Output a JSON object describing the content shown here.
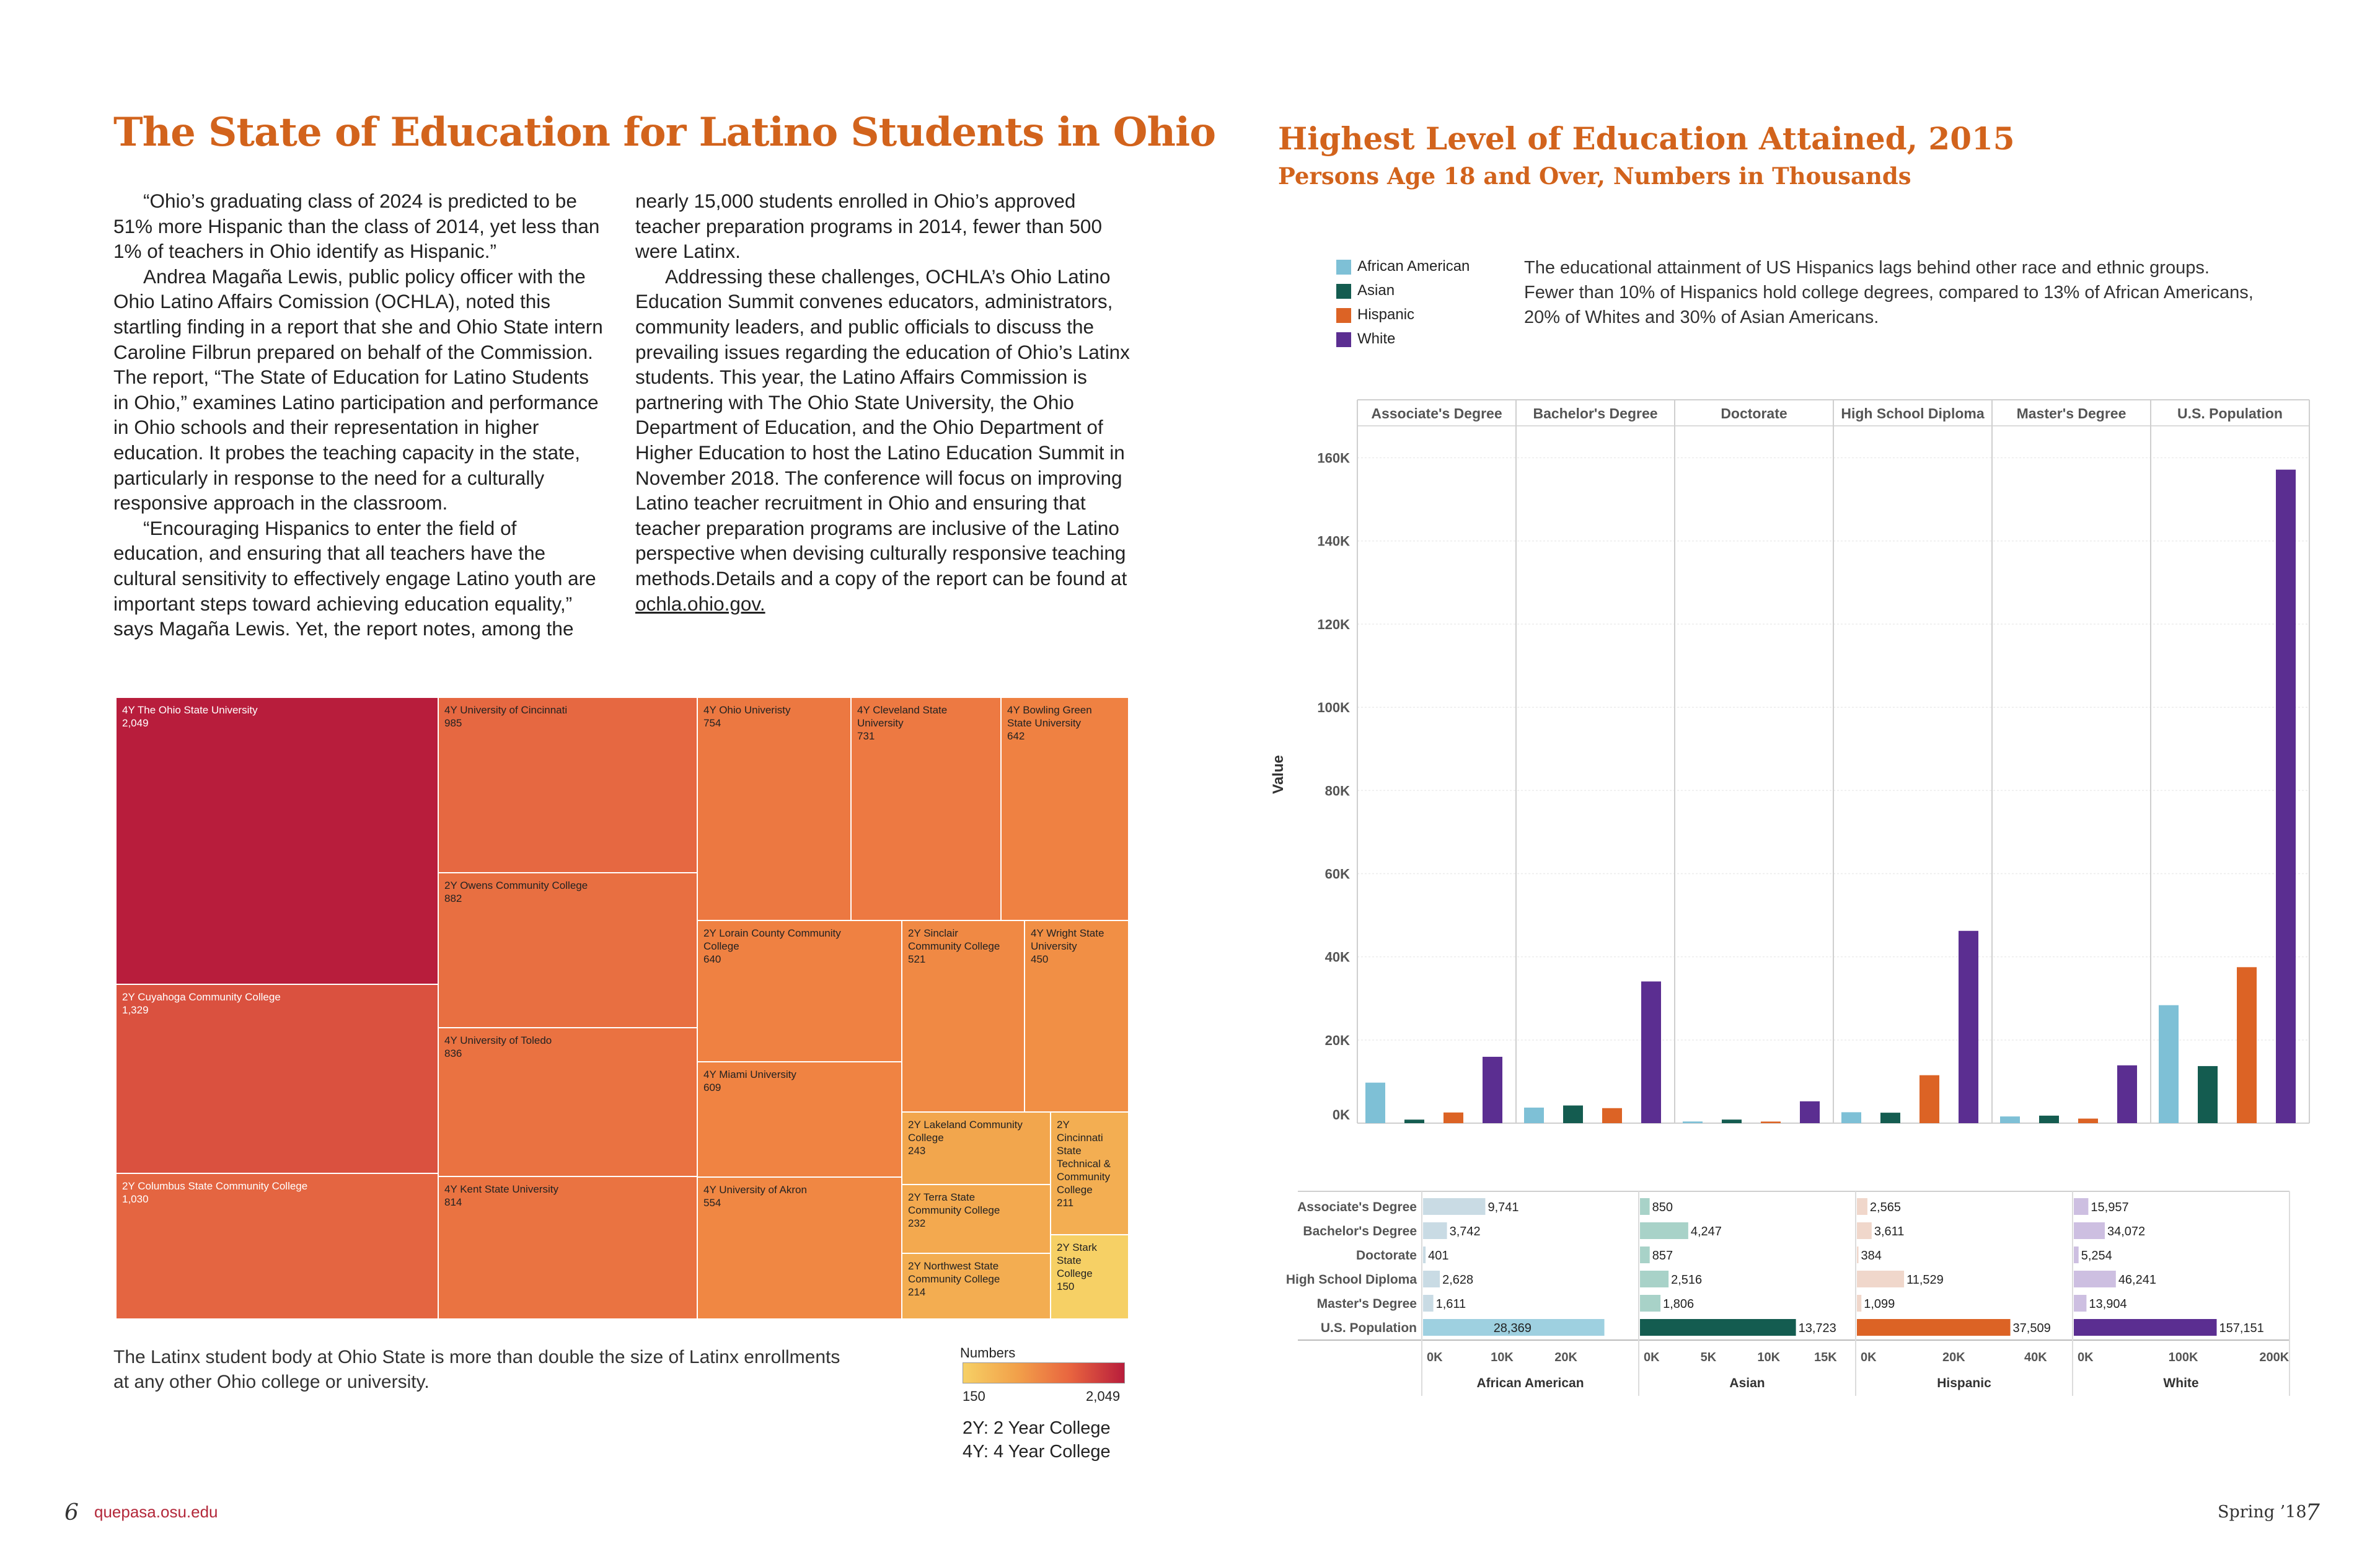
{
  "left_page": {
    "title": "The State of Education for Latino Students in Ohio",
    "col1": [
      "“Ohio’s graduating class of 2024 is predicted to be 51% more Hispanic than the class of 2014, yet less than 1% of teachers in Ohio identify as Hispanic.”",
      "Andrea Magaña Lewis, public policy officer with the Ohio Latino Affairs Comission (OCHLA), noted this startling finding in a report that she and Ohio State intern Caroline Filbrun prepared on behalf of the Commission. The report, “The State of Education for Latino Students in Ohio,” examines Latino participation and performance in Ohio schools and their representation in higher education. It probes the teaching capacity in the state, particularly in response to the need for a culturally responsive approach in the classroom.",
      "“Encouraging Hispanics to enter the field of education, and ensuring that all teachers have the cultural sensitivity to effectively engage Latino youth are important steps toward achieving education equality,” says Magaña Lewis. Yet, the report notes, among the"
    ],
    "col2_p1": "nearly 15,000 students enrolled in Ohio’s approved teacher preparation programs in 2014, fewer than 500 were Latinx.",
    "col2_p2": "Addressing these challenges, OCHLA’s Ohio Latino Education Summit convenes educators, administrators, community leaders, and public officials to discuss the prevailing issues regarding the education of Ohio’s Latinx students. This year, the Latino Affairs Commission is partnering with The Ohio State University, the Ohio Department of Education, and the Ohio Department of Higher Education to host the Latino Education Summit in November 2018. The conference will focus on improving Latino teacher recruitment in Ohio and ensuring that teacher preparation programs are inclusive of the Latino perspective when devising culturally responsive teaching methods.Details and a copy of the report can be found at",
    "col2_link": "ochla.ohio.gov.",
    "caption": "The Latinx student body at Ohio State is more than double the size of Latinx enrollments at any other Ohio college or university.",
    "numbers_legend": {
      "title": "Numbers",
      "min": "150",
      "max": "2,049"
    },
    "key_2y": "2Y: 2 Year College",
    "key_4y": "4Y: 4 Year College",
    "page_number": "6",
    "url": "quepasa.osu.edu"
  },
  "right_page": {
    "title": "Highest Level of Education Attained, 2015",
    "subtitle": "Persons Age 18 and Over, Numbers in Thousands",
    "blurb": "The educational attainment of US Hispanics lags behind other race and ethnic groups.  Fewer than 10% of Hispanics hold college degrees, compared to 13% of African Americans, 20% of Whites and 30% of Asian Americans.",
    "legend": [
      {
        "label": "African American",
        "color": "#7ec0d6"
      },
      {
        "label": "Asian",
        "color": "#145c50"
      },
      {
        "label": "Hispanic",
        "color": "#dc6325"
      },
      {
        "label": "White",
        "color": "#5b2e91"
      }
    ],
    "footer_issue": "Spring ’18",
    "page_number": "7"
  },
  "chart_data": [
    {
      "type": "treemap",
      "color_legend": "Numbers",
      "items": [
        {
          "label": "4Y The Ohio State University",
          "value": 2049,
          "display": "2,049"
        },
        {
          "label": "2Y Cuyahoga Community College",
          "value": 1329,
          "display": "1,329"
        },
        {
          "label": "2Y Columbus State Community College",
          "value": 1030,
          "display": "1,030"
        },
        {
          "label": "4Y University of Cincinnati",
          "value": 985,
          "display": "985"
        },
        {
          "label": "2Y Owens Community College",
          "value": 882,
          "display": "882"
        },
        {
          "label": "4Y University of Toledo",
          "value": 836,
          "display": "836"
        },
        {
          "label": "4Y Kent State University",
          "value": 814,
          "display": "814"
        },
        {
          "label": "4Y Ohio Univeristy",
          "value": 754,
          "display": "754"
        },
        {
          "label": "4Y Cleveland State University",
          "value": 731,
          "display": "731"
        },
        {
          "label": "4Y Bowling Green State University",
          "value": 642,
          "display": "642"
        },
        {
          "label": "2Y Lorain County Community College",
          "value": 640,
          "display": "640"
        },
        {
          "label": "4Y Miami University",
          "value": 609,
          "display": "609"
        },
        {
          "label": "4Y University of Akron",
          "value": 554,
          "display": "554"
        },
        {
          "label": "2Y Sinclair Community College",
          "value": 521,
          "display": "521"
        },
        {
          "label": "4Y Wright State University",
          "value": 450,
          "display": "450"
        },
        {
          "label": "2Y Lakeland Community College",
          "value": 243,
          "display": "243"
        },
        {
          "label": "2Y Terra State Community College",
          "value": 232,
          "display": "232"
        },
        {
          "label": "2Y Northwest State Community College",
          "value": 214,
          "display": "214"
        },
        {
          "label": "2Y Cincinnati State Technical & Community College",
          "value": 211,
          "display": "211"
        },
        {
          "label": "2Y Stark State College",
          "value": 150,
          "display": "150"
        }
      ]
    },
    {
      "type": "bar",
      "title": "Highest Level of Education Attained, 2015",
      "subtitle": "Persons Age 18 and Over, Numbers in Thousands",
      "ylabel": "Value",
      "ylim": [
        0,
        165
      ],
      "yticks": [
        "0K",
        "20K",
        "40K",
        "60K",
        "80K",
        "100K",
        "120K",
        "140K",
        "160K"
      ],
      "categories": [
        "Associate's Degree",
        "Bachelor's Degree",
        "Doctorate",
        "High School Diploma",
        "Master's Degree",
        "U.S. Population"
      ],
      "series": [
        {
          "name": "African American",
          "values": [
            9741,
            3742,
            401,
            2628,
            1611,
            28369
          ]
        },
        {
          "name": "Asian",
          "values": [
            850,
            4247,
            857,
            2516,
            1806,
            13723
          ]
        },
        {
          "name": "Hispanic",
          "values": [
            2565,
            3611,
            384,
            11529,
            1099,
            37509
          ]
        },
        {
          "name": "White",
          "values": [
            15957,
            34072,
            5254,
            46241,
            13904,
            157151
          ]
        }
      ]
    },
    {
      "type": "table",
      "rows": [
        "Associate's Degree",
        "Bachelor's Degree",
        "Doctorate",
        "High School Diploma",
        "Master's Degree",
        "U.S. Population"
      ],
      "groups": [
        {
          "name": "African American",
          "labels": [
            "9,741",
            "3,742",
            "401",
            "2,628",
            "1,611",
            "28,369"
          ],
          "values": [
            9741,
            3742,
            401,
            2628,
            1611,
            28369
          ],
          "max": 32,
          "ticks": [
            "0K",
            "10K",
            "20K"
          ],
          "tick_values": [
            0,
            10,
            20
          ]
        },
        {
          "name": "Asian",
          "labels": [
            "850",
            "4,247",
            "857",
            "2,516",
            "1,806",
            "13,723"
          ],
          "values": [
            850,
            4247,
            857,
            2516,
            1806,
            13723
          ],
          "max": 18,
          "ticks": [
            "0K",
            "5K",
            "10K",
            "15K"
          ],
          "tick_values": [
            0,
            5,
            10,
            15
          ]
        },
        {
          "name": "Hispanic",
          "labels": [
            "2,565",
            "3,611",
            "384",
            "11,529",
            "1,099",
            "37,509"
          ],
          "values": [
            2565,
            3611,
            384,
            11529,
            1099,
            37509
          ],
          "max": 50,
          "ticks": [
            "0K",
            "20K",
            "40K"
          ],
          "tick_values": [
            0,
            20,
            40
          ]
        },
        {
          "name": "White",
          "labels": [
            "15,957",
            "34,072",
            "5,254",
            "46,241",
            "13,904",
            "157,151"
          ],
          "values": [
            15957,
            34072,
            5254,
            46241,
            13904,
            157151
          ],
          "max": 225,
          "ticks": [
            "0K",
            "100K",
            "200K"
          ],
          "tick_values": [
            0,
            100,
            200
          ]
        }
      ]
    }
  ]
}
